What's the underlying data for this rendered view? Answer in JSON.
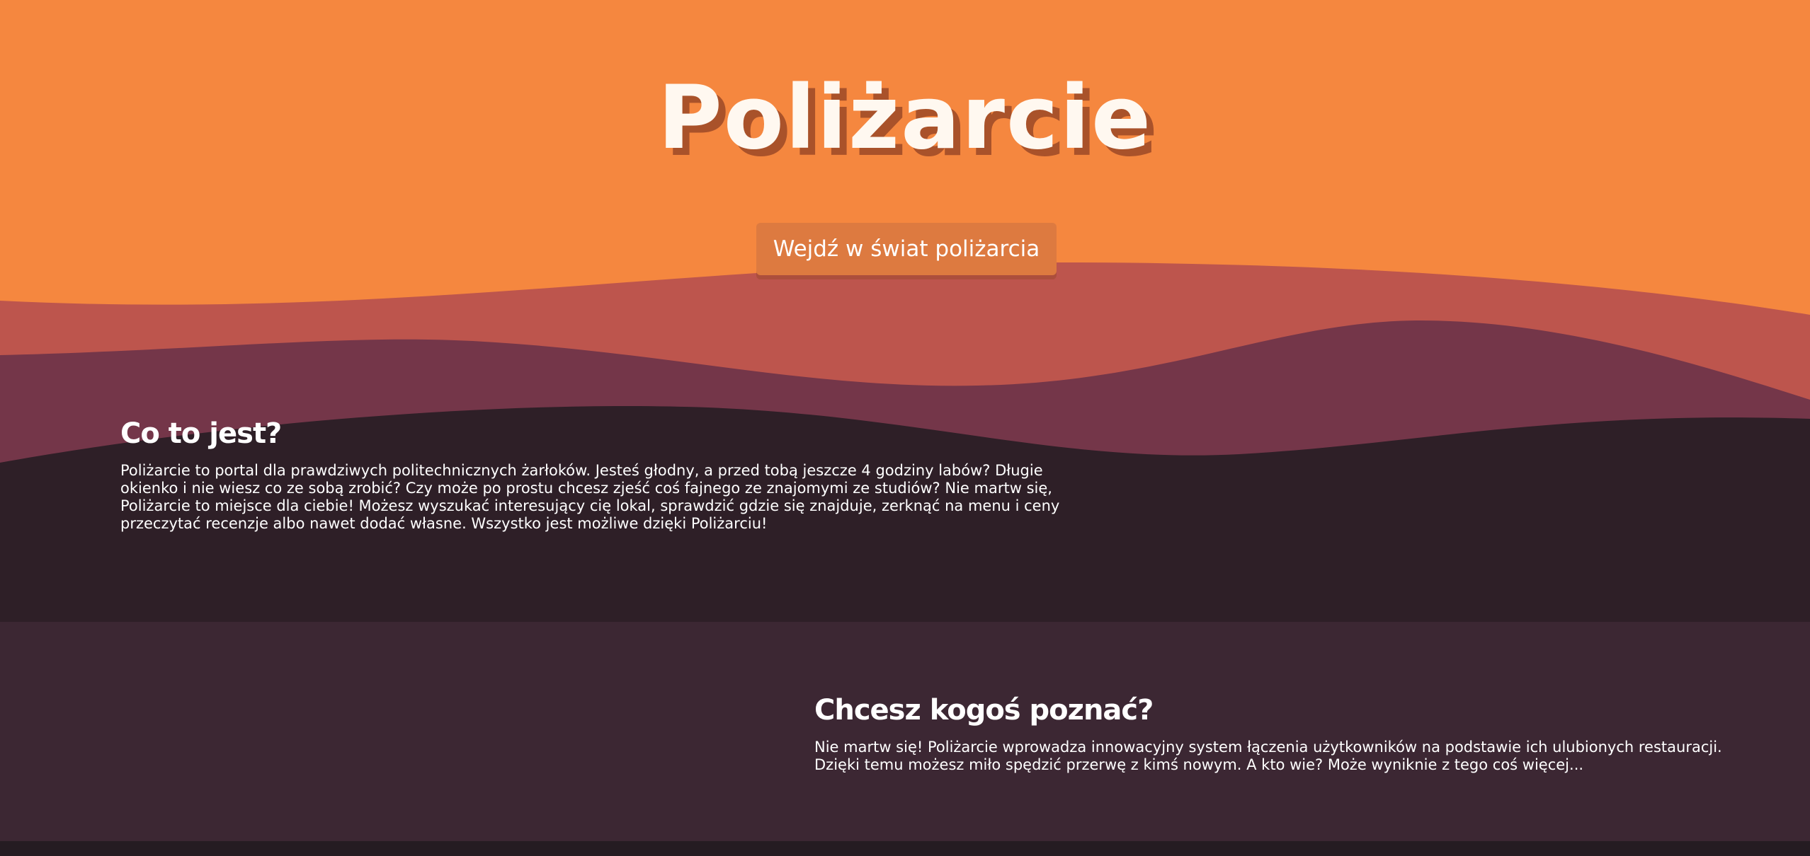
{
  "colors": {
    "orange": "#f5873f",
    "coral": "#bd554d",
    "plum": "#743649",
    "dark": "#2e1f27",
    "section": "#3c2733",
    "footer": "#251c22",
    "button": "#dd7a40",
    "title_shadow": "#a9522a"
  },
  "hero": {
    "title": "Poliżarcie",
    "button_label": "Wejdź w świat poliżarcia"
  },
  "about": {
    "heading": "Co to jest?",
    "text": "Poliżarcie to portal dla prawdziwych politechnicznych żarłoków. Jesteś głodny, a przed tobą jeszcze 4 godziny labów? Długie okienko i nie wiesz co ze sobą zrobić? Czy może po prostu chcesz zjeść coś fajnego ze znajomymi ze studiów? Nie martw się, Poliżarcie to miejsce dla ciebie! Możesz wyszukać interesujący cię lokal, sprawdzić gdzie się znajduje, zerknąć na menu i ceny przeczytać recenzje albo nawet dodać własne. Wszystko jest możliwe dzięki Poliżarciu!"
  },
  "meet": {
    "heading": "Chcesz kogoś poznać?",
    "text": "Nie martw się! Poliżarcie wprowadza innowacyjny system łączenia użytkowników na podstawie ich ulubionych restauracji. Dzięki temu możesz miło spędzić przerwę z kimś nowym. A kto wie? Może wyniknie z tego coś więcej..."
  }
}
